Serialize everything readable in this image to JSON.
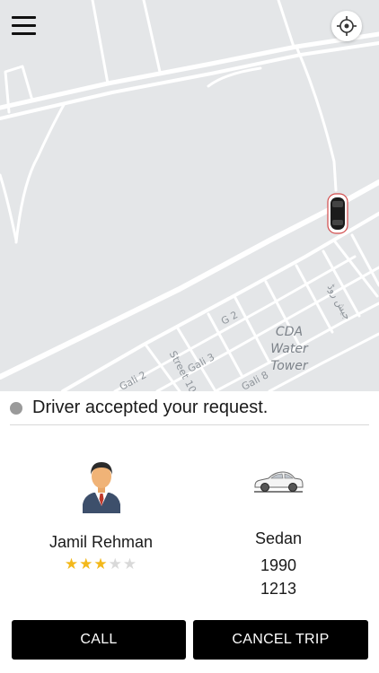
{
  "map": {
    "labels": {
      "poi": "CDA Water Tower",
      "g2": "G 2",
      "gali2": "Gali 2",
      "gali3": "Gali 3",
      "gali8": "Gali 8",
      "street10": "Street 10",
      "urdu_road": "جیش روڈ"
    },
    "menu_icon": "hamburger-menu-icon",
    "locate_icon": "crosshair-location-icon",
    "car_icon": "car-marker-icon"
  },
  "status": {
    "text": "Driver accepted your request.",
    "dot_color": "#9a9a9a"
  },
  "driver": {
    "name": "Jamil Rehman",
    "rating": 3,
    "rating_max": 5,
    "avatar_icon": "driver-avatar-icon"
  },
  "vehicle": {
    "type": "Sedan",
    "year": "1990",
    "plate": "1213",
    "icon": "sedan-car-icon"
  },
  "actions": {
    "call_label": "CALL",
    "cancel_label": "CANCEL TRIP",
    "button_color": "#000000"
  },
  "colors": {
    "map_background": "#e4e6e8",
    "star_on": "#f3b81a",
    "star_off": "#d9d9d9"
  }
}
